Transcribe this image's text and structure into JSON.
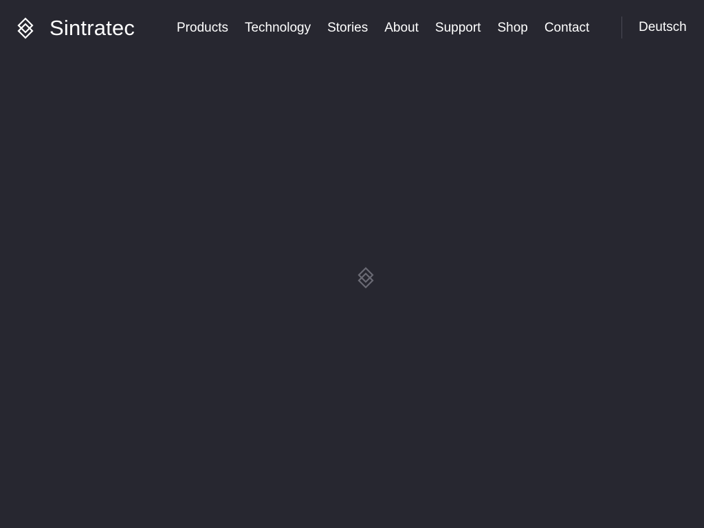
{
  "brand": {
    "name": "Sintratec",
    "icon": "sintratec-logo-icon"
  },
  "nav": {
    "items": [
      {
        "label": "Products"
      },
      {
        "label": "Technology"
      },
      {
        "label": "Stories"
      },
      {
        "label": "About"
      },
      {
        "label": "Support"
      },
      {
        "label": "Shop"
      },
      {
        "label": "Contact"
      }
    ],
    "language_label": "Deutsch"
  },
  "loader": {
    "icon": "sintratec-logo-icon"
  },
  "colors": {
    "background": "#272730",
    "text": "#ffffff",
    "divider": "#4a4a55",
    "loader_icon": "#6a6a74"
  }
}
